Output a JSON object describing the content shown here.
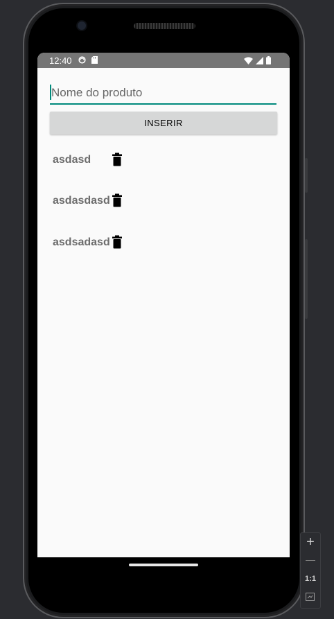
{
  "status_bar": {
    "time": "12:40",
    "left_icons": [
      "sync-icon",
      "sd-card-icon"
    ],
    "right_icons": [
      "wifi-icon",
      "signal-icon",
      "battery-icon"
    ]
  },
  "form": {
    "input_placeholder": "Nome do produto",
    "insert_label": "INSERIR"
  },
  "products": [
    {
      "name": "asdasd"
    },
    {
      "name": "asdasdasd"
    },
    {
      "name": "asdsadasd"
    }
  ],
  "emulator_zoom": {
    "zoom_in": "+",
    "zoom_out": "—",
    "actual_size": "1:1"
  },
  "colors": {
    "accent": "#00897b",
    "status_bar": "#757575",
    "button": "#d6d7d7"
  }
}
